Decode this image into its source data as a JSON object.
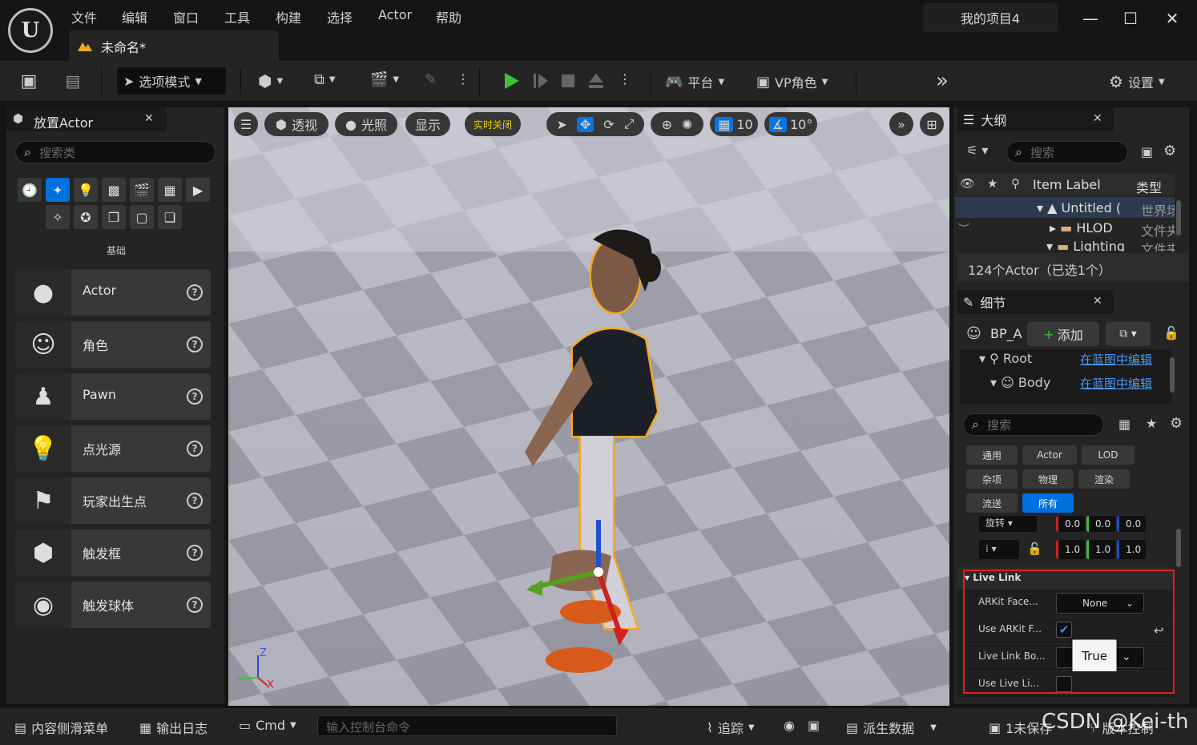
{
  "app": {
    "logo": "U",
    "project_name": "我的项目4",
    "document_tab": "未命名*"
  },
  "menu": [
    "文件",
    "编辑",
    "窗口",
    "工具",
    "构建",
    "选择",
    "Actor",
    "帮助"
  ],
  "toolbar": {
    "mode_label": "选项模式",
    "platform_label": "平台",
    "vp_label": "VP角色",
    "settings_label": "设置"
  },
  "place_actor": {
    "panel_title": "放置Actor",
    "search_placeholder": "搜索类",
    "category_label": "基础",
    "items": [
      {
        "label": "Actor",
        "icon": "sphere-on-pedestal-icon"
      },
      {
        "label": "角色",
        "icon": "character-icon"
      },
      {
        "label": "Pawn",
        "icon": "pawn-icon"
      },
      {
        "label": "点光源",
        "icon": "point-light-icon"
      },
      {
        "label": "玩家出生点",
        "icon": "player-start-icon"
      },
      {
        "label": "触发框",
        "icon": "trigger-box-icon"
      },
      {
        "label": "触发球体",
        "icon": "trigger-sphere-icon"
      }
    ]
  },
  "viewport": {
    "perspective": "透视",
    "lighting": "光照",
    "show": "显示",
    "realtime": "实时关闭",
    "grid_snap": "10",
    "rotation_snap": "10°",
    "axis_z": "Z",
    "axis_x": "X"
  },
  "outliner": {
    "title": "大纲",
    "search_placeholder": "搜索",
    "col_label": "Item Label",
    "col_type": "类型",
    "rows": [
      {
        "name": "Untitled",
        "extra": "(",
        "type": "世界场"
      },
      {
        "name": "HLOD",
        "type": "文件夹"
      },
      {
        "name": "Lighting",
        "type": "文件夹"
      }
    ],
    "count": "124个Actor（已选1个）"
  },
  "details": {
    "title": "细节",
    "actor_name": "BP_A",
    "add_label": "添加",
    "components": [
      {
        "name": "Root",
        "link": "在蓝图中编辑"
      },
      {
        "name": "Body",
        "link": "在蓝图中编辑"
      }
    ],
    "search_placeholder": "搜索",
    "filters": [
      "通用",
      "Actor",
      "LOD",
      "杂项",
      "物理",
      "渲染",
      "流送",
      "所有"
    ],
    "active_filter": "所有",
    "rotation_label": "旋转",
    "rotation_values": [
      "0.0",
      "0.0",
      "0.0"
    ],
    "scale_values": [
      "1.0",
      "1.0",
      "1.0"
    ],
    "live_link": {
      "section": "Live Link",
      "rows": [
        {
          "label": "ARKit Face...",
          "value": "None"
        },
        {
          "label": "Use ARKit F...",
          "checked": true
        },
        {
          "label": "Live Link Bo..."
        },
        {
          "label": "Use Live Li..."
        }
      ],
      "tooltip": "True"
    }
  },
  "statusbar": {
    "content_drawer": "内容侧滑菜单",
    "output_log": "输出日志",
    "cmd": "Cmd",
    "cmd_placeholder": "输入控制台命令",
    "trace": "追踪",
    "derived_data": "派生数据",
    "unsaved": "1未保存",
    "source_control": "版本控制",
    "watermark": "CSDN @Kei-th"
  },
  "colors": {
    "accent": "#0070e0",
    "selection": "#f5a623",
    "play_green": "#3cc13c",
    "highlight_red": "#e02020"
  }
}
